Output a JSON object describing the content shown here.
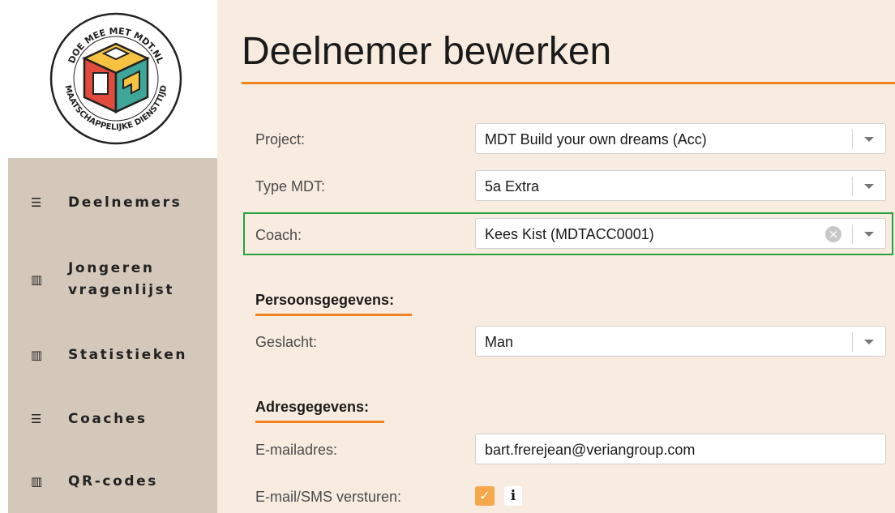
{
  "logo": {
    "top_text": "DOE MEE MET MDT.NL",
    "bottom_text": "MAATSCHAPPELIJKE DIENSTTIJD"
  },
  "nav": {
    "items": [
      {
        "icon": "list-icon",
        "glyph": "☰",
        "label": "Deelnemers"
      },
      {
        "icon": "chart-icon",
        "glyph": "▥",
        "label": "Jongeren vragenlijst"
      },
      {
        "icon": "chart-icon",
        "glyph": "▥",
        "label": "Statistieken"
      },
      {
        "icon": "list-icon",
        "glyph": "☰",
        "label": "Coaches"
      },
      {
        "icon": "chart-icon",
        "glyph": "▥",
        "label": "QR-codes"
      }
    ]
  },
  "page": {
    "title": "Deelnemer bewerken"
  },
  "form": {
    "project": {
      "label": "Project:",
      "value": "MDT Build your own dreams (Acc)"
    },
    "type_mdt": {
      "label": "Type MDT:",
      "value": "5a Extra"
    },
    "coach": {
      "label": "Coach:",
      "value": "Kees Kist (MDTACC0001)"
    },
    "persoons_section": "Persoonsgegevens:",
    "geslacht": {
      "label": "Geslacht:",
      "value": "Man"
    },
    "adres_section": "Adresgegevens:",
    "email": {
      "label": "E-mailadres:",
      "value": "bart.frerejean@veriangroup.com"
    },
    "send": {
      "label": "E-mail/SMS versturen:",
      "checked": true
    }
  },
  "colors": {
    "accent_orange": "#f0831e",
    "highlight_green": "#2aa13d",
    "sidebar_bg": "#d4c8bb",
    "main_bg": "#f8ece0"
  }
}
